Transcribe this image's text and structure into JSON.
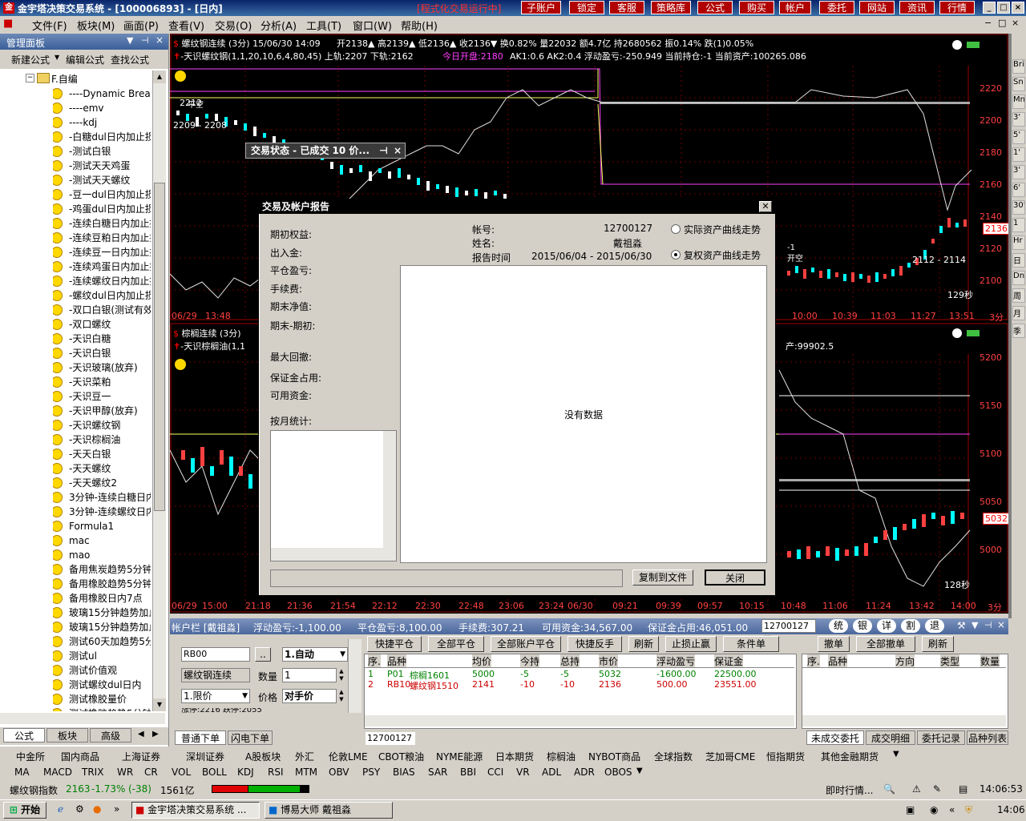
{
  "app": {
    "logo_glyph": "金",
    "title": "金宇塔决策交易系统 - [100006893] - [日内]",
    "status_text": "[程式化交易运行中]",
    "top_buttons": [
      "子账户",
      "锁定",
      "客服",
      "策略库",
      "公式",
      "购买",
      "帐户",
      "委托",
      "网站",
      "资讯",
      "行情"
    ],
    "window_controls": [
      "_",
      "□",
      "×"
    ]
  },
  "menubar": {
    "items": [
      "文件(F)",
      "板块(M)",
      "画面(P)",
      "查看(V)",
      "交易(O)",
      "分析(A)",
      "工具(T)",
      "窗口(W)",
      "帮助(H)"
    ]
  },
  "left_panel": {
    "title": "管理面板",
    "tools": [
      "新建公式",
      "编辑公式",
      "查找公式"
    ],
    "folder": "F.自编",
    "items": [
      "----Dynamic Break",
      "----emv",
      "----kdj",
      "-白糖dul日内加止损",
      "-测试白银",
      "-测试天天鸡蛋",
      "-测试天天螺纹",
      "-豆一dul日内加止损",
      "-鸡蛋dul日内加止损",
      "-连续白糖日内加止损",
      "-连续豆粕日内加止损",
      "-连续豆一日内加止损",
      "-连续鸡蛋日内加止损",
      "-连续螺纹日内加止损",
      "-螺纹dul日内加止损",
      "-双口白银(测试有效)",
      "-双口螺纹",
      "-天识白糖",
      "-天识白银",
      "-天识玻璃(放弃)",
      "-天识菜粕",
      "-天识豆一",
      "-天识甲醇(放弃)",
      "-天识螺纹钢",
      "-天识棕榈油",
      "-天天白银",
      "-天天螺纹",
      "-天天螺纹2",
      "3分钟-连续白糖日内",
      "3分钟-连续螺纹日内",
      "Formula1",
      "mac",
      "mao",
      "备用焦炭趋势5分钟",
      "备用橡胶趋势5分钟",
      "备用橡胶日内7点",
      "玻璃15分钟趋势加止",
      "玻璃15分钟趋势加止",
      "测试60天加趋势5分",
      "测试ul",
      "测试价值观",
      "测试螺纹dul日内",
      "测试橡胶量价",
      "测试橡胶趋势5分钟"
    ],
    "tabs": [
      "公式",
      "板块",
      "高级"
    ]
  },
  "chart_top": {
    "title": "螺纹钢连续 (3分) 15/06/30 14:09",
    "quote": "开2138▲ 高2139▲ 低2136▲ 收2136▼ 换0.82% 量22032 额4.7亿 持2680562 振0.14% 跌(1)0.05%",
    "indicator": "-天识螺纹钢(1,1,20,10,6,4,80,45) 上轨:2207 下轨:2162",
    "today_open": "今日开盘:2180",
    "ak": "AK1:0.6 AK2:0.4 浮动盈亏:-250.949 当前持仓:-1 当前资产:100265.086",
    "y_labels": [
      "2220",
      "2200",
      "2180",
      "2160",
      "2140",
      "2120",
      "2100"
    ],
    "price_tag": "2136",
    "x_labels": [
      "06/29",
      "13:48",
      "14:",
      "10:00",
      "10:39",
      "11:03",
      "11:27",
      "13:51",
      "3分"
    ],
    "annot_left1": "2209 - 2208",
    "annot_left2": "2212",
    "annot_left3": "平空",
    "annot_right1": "2112 - 2114",
    "annot_right2": "开空",
    "annot_right3": "-1",
    "countdown": "129秒"
  },
  "chart_bottom": {
    "title": "棕榈连续 (3分)",
    "indicator": "-天识棕榈油(1,1",
    "right_text": "产:99902.5",
    "y_labels": [
      "5200",
      "5150",
      "5100",
      "5050",
      "5000"
    ],
    "price_tag": "5032",
    "x_labels": [
      "06/29",
      "15:00",
      "21:18",
      "21:36",
      "21:54",
      "22:12",
      "22:30",
      "22:48",
      "23:06",
      "23:24",
      "06/30",
      "09:21",
      "09:39",
      "09:57",
      "10:15",
      "10:48",
      "11:06",
      "11:24",
      "13:42",
      "14:00",
      "3分"
    ],
    "countdown": "128秒"
  },
  "small_dialog": {
    "title": "交易状态 - 已成交 10 价..."
  },
  "report_dialog": {
    "title": "交易及帐户报告",
    "left_labels": [
      "期初权益:",
      "出入金:",
      "平仓盈亏:",
      "手续费:",
      "期末净值:",
      "期末-期初:",
      "最大回撤:",
      "保证金占用:",
      "可用资金:",
      "按月统计:"
    ],
    "account_label": "帐号:",
    "account_value": "12700127",
    "name_label": "姓名:",
    "name_value": "戴祖淼",
    "period_label": "报告时间",
    "period_value": "2015/06/04 - 2015/06/30",
    "radio1": "实际资产曲线走势",
    "radio2": "复权资产曲线走势",
    "no_data": "没有数据",
    "copy_btn": "复制到文件",
    "close_btn": "关闭"
  },
  "account_bar": {
    "title": "帐户栏 [戴祖淼]",
    "float_pl": "浮动盈亏:-1,100.00",
    "close_pl": "平仓盈亏:8,100.00",
    "fee": "手续费:307.21",
    "avail": "可用资金:34,567.00",
    "margin": "保证金占用:46,051.00",
    "account_select": "12700127",
    "circle_btns": [
      "统",
      "银",
      "详",
      "割",
      "退"
    ]
  },
  "order_panel": {
    "symbol": "RB00",
    "dots": "..",
    "mode": "1.自动",
    "name": "螺纹钢连续",
    "qty_label": "数量",
    "qty": "1",
    "price_type": "1.限价",
    "price_label": "价格",
    "price": "对手价",
    "cut_text": "涨停:2216 跌停:2055",
    "tabs": [
      "普通下单",
      "闪电下单"
    ]
  },
  "position_panel": {
    "buttons": [
      "快捷平仓",
      "全部平仓",
      "全部账户平仓",
      "快捷反手",
      "刷新",
      "止损止赢",
      "条件单"
    ],
    "columns": [
      "序.",
      "品种",
      "均价",
      "今持",
      "总持",
      "市价",
      "浮动盈亏",
      "保证金"
    ],
    "rows": [
      {
        "idx": "1",
        "code": "P01",
        "name": "棕榈1601",
        "avg": "5000",
        "today": "-5",
        "total": "-5",
        "mkt": "5032",
        "pl": "-1600.00",
        "margin": "22500.00",
        "color": "#008000"
      },
      {
        "idx": "2",
        "code": "RB10",
        "name": "螺纹钢1510",
        "avg": "2141",
        "today": "-10",
        "total": "-10",
        "mkt": "2136",
        "pl": "500.00",
        "margin": "23551.00",
        "color": "#cc0000"
      }
    ],
    "account_tab": "12700127"
  },
  "order_list": {
    "buttons": [
      "撤单",
      "全部撤单",
      "刷新"
    ],
    "columns": [
      "序.",
      "品种",
      "方向",
      "类型",
      "数量"
    ],
    "tabs": [
      "未成交委托",
      "成交明细",
      "委托记录",
      "品种列表"
    ]
  },
  "market_bar": {
    "items": [
      "中金所",
      "国内商品",
      "上海证券",
      "深圳证券",
      "A股板块",
      "外汇",
      "伦敦LME",
      "CBOT粮油",
      "NYME能源",
      "日本期货",
      "棕榈油",
      "NYBOT商品",
      "全球指数",
      "芝加哥CME",
      "恒指期货",
      "其他金融期货"
    ]
  },
  "indicator_bar": {
    "items": [
      "MA",
      "MACD",
      "TRIX",
      "WR",
      "CR",
      "VOL",
      "BOLL",
      "KDJ",
      "RSI",
      "MTM",
      "OBV",
      "PSY",
      "BIAS",
      "SAR",
      "BBI",
      "CCI",
      "VR",
      "ADL",
      "ADR",
      "OBOS"
    ]
  },
  "status_bar": {
    "index": "螺纹钢指数",
    "price": "2163",
    "change": "-1.73%",
    "diff": "(-38)",
    "amount": "1561亿",
    "realtime": "即时行情...",
    "time": "14:06:53"
  },
  "taskbar": {
    "start": "开始",
    "tasks": [
      "金宇塔决策交易系统 ...",
      "博易大师 戴祖淼"
    ],
    "clock": "14:06"
  },
  "right_strip": {
    "items": [
      "Bri",
      "Sn",
      "Mn",
      "3'",
      "5'",
      "1'",
      "3'",
      "6'",
      "30'",
      "1",
      "Hr",
      "日",
      "Dn",
      "周",
      "月",
      "季"
    ]
  }
}
